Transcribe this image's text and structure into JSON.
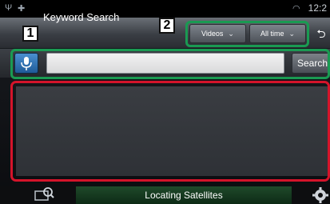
{
  "statusbar": {
    "left_icons": [
      "usb-icon",
      "android-icon"
    ],
    "right_icon": "wifi-icon",
    "time": "12:2"
  },
  "header": {
    "title": "Keyword Search",
    "filters": [
      {
        "label": "Videos"
      },
      {
        "label": "All time"
      }
    ],
    "back_icon": "back-arrow-icon"
  },
  "search": {
    "mic_icon": "microphone-icon",
    "input_value": "",
    "button_label": "Search"
  },
  "footer": {
    "status": "Locating Satellites",
    "left_icon": "map-search-icon",
    "right_icon": "gear-icon"
  },
  "callouts": [
    {
      "number": "1"
    },
    {
      "number": "2"
    }
  ],
  "colors": {
    "callout_green": "#1a9a52",
    "callout_red": "#d4142a",
    "status_strip": "#1f4a2a"
  }
}
